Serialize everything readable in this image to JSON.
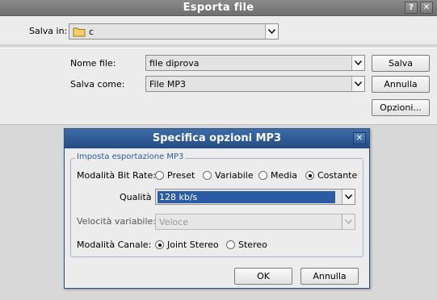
{
  "window": {
    "title": "Esporta file",
    "help_glyph": "?",
    "close_glyph": "✕"
  },
  "top": {
    "look_in_label": "Salva in:",
    "look_in_value": "c"
  },
  "file": {
    "name_label": "Nome file:",
    "name_value": "file diprova",
    "type_label": "Salva come:",
    "type_value": "File MP3",
    "save_button": "Salva",
    "cancel_button": "Annulla",
    "options_button": "Opzioni..."
  },
  "dialog": {
    "title": "Specifica opzioni MP3",
    "close_glyph": "✕",
    "group_title": "Imposta esportazione MP3",
    "bitrate_mode_label": "Modalità Bit Rate:",
    "bitrate_modes": [
      "Preset",
      "Variabile",
      "Media",
      "Costante"
    ],
    "bitrate_mode_selected": "Costante",
    "quality_label": "Qualità",
    "quality_value": "128 kb/s",
    "variable_speed_label": "Velocità variabile:",
    "variable_speed_value": "Veloce",
    "channel_mode_label": "Modalità Canale:",
    "channel_modes": [
      "Joint Stereo",
      "Stereo"
    ],
    "channel_mode_selected": "Joint Stereo",
    "ok_button": "OK",
    "cancel_button": "Annulla"
  },
  "colors": {
    "dialog_title_bg": "#2f5a93",
    "selection": "#2b5ca3",
    "group_title": "#2e5f9a"
  }
}
